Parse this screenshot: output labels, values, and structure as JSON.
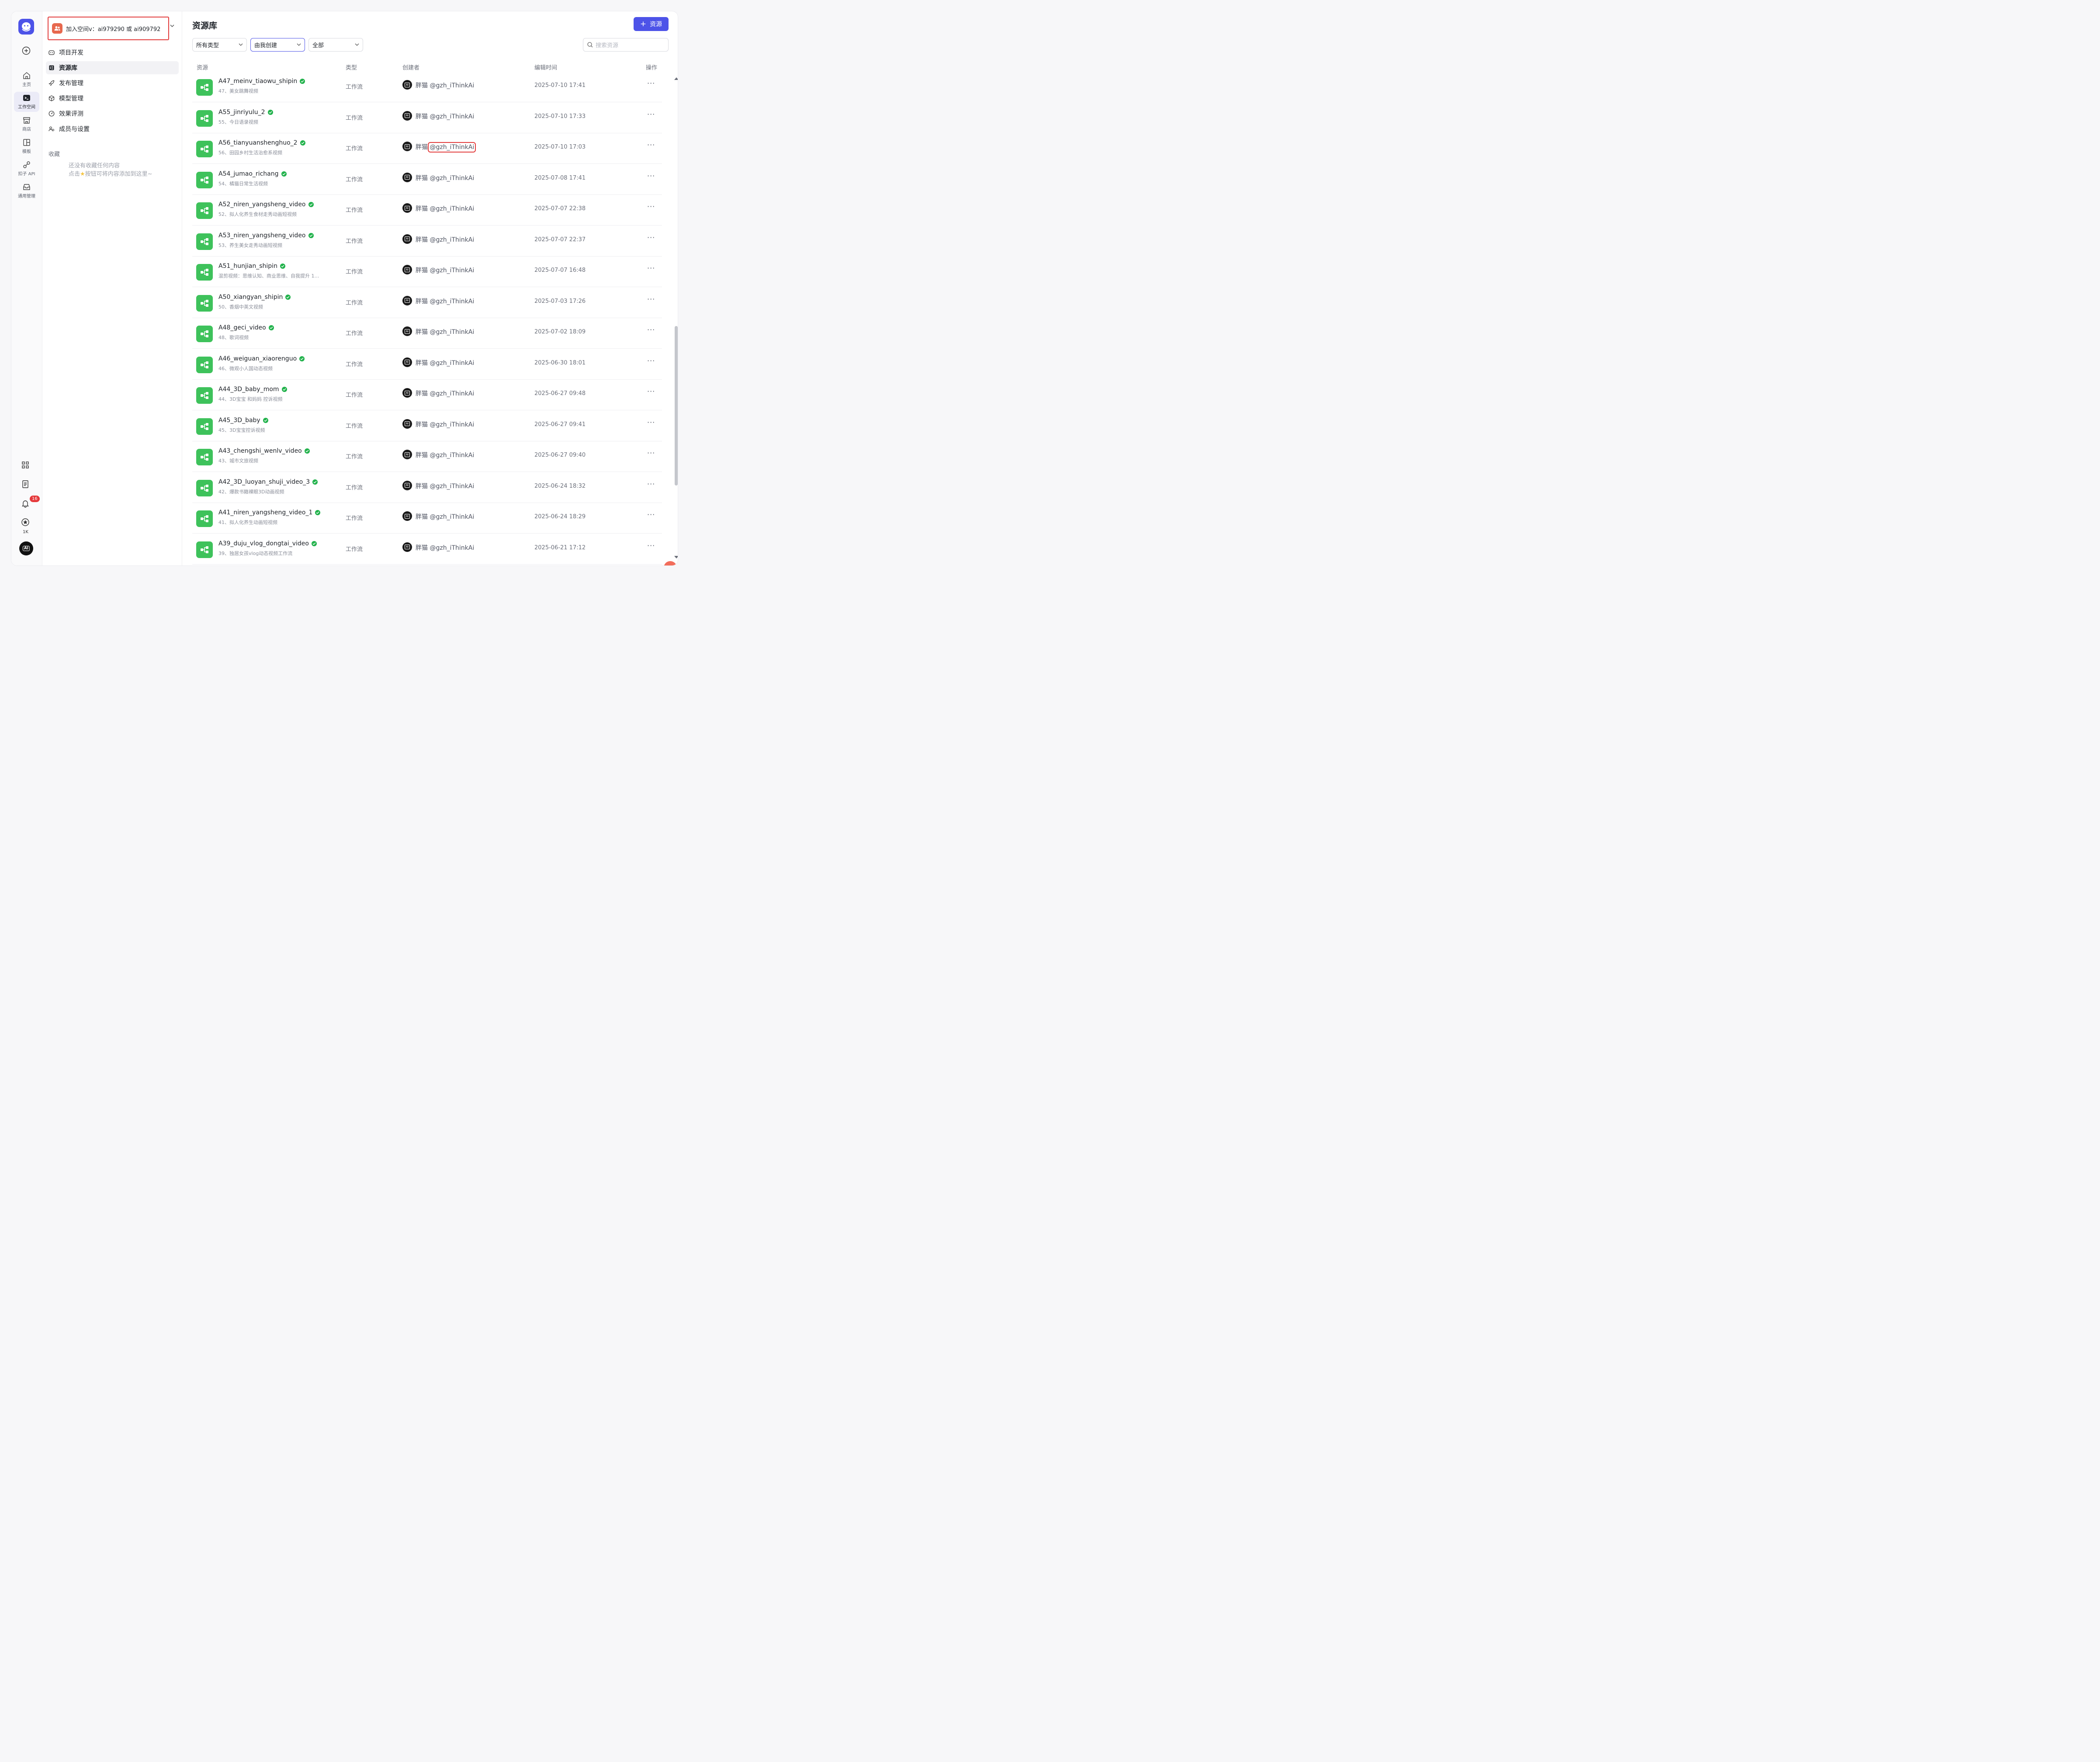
{
  "rail": {
    "items": [
      {
        "name": "home",
        "label": "主页"
      },
      {
        "name": "workspace",
        "label": "工作空间"
      },
      {
        "name": "store",
        "label": "商店"
      },
      {
        "name": "templates",
        "label": "模板"
      },
      {
        "name": "api",
        "label": "扣子 API"
      },
      {
        "name": "general",
        "label": "通用管理"
      }
    ],
    "notification_count": "16",
    "favorites_count": "1K",
    "avatar_text": "AI"
  },
  "subnav": {
    "space_label": "加入空间v：ai979290 或 ai909792",
    "items": [
      {
        "label": "项目开发"
      },
      {
        "label": "资源库"
      },
      {
        "label": "发布管理"
      },
      {
        "label": "模型管理"
      },
      {
        "label": "效果评测"
      },
      {
        "label": "成员与设置"
      }
    ],
    "favorites_title": "收藏",
    "favorites_empty_line1": "还没有收藏任何内容",
    "favorites_empty_line2_a": "点击",
    "favorites_empty_line2_b": "按钮可将内容添加到这里~"
  },
  "main": {
    "title": "资源库",
    "add_button": "资源",
    "filters": {
      "type": "所有类型",
      "creator": "由我创建",
      "status": "全部"
    },
    "search_placeholder": "搜索资源",
    "columns": {
      "resource": "资源",
      "type": "类型",
      "creator": "创建者",
      "edited": "编辑时间",
      "action": "操作"
    },
    "rows": [
      {
        "name": "A47_meinv_tiaowu_shipin",
        "desc": "47、美女跳舞视频",
        "type": "工作流",
        "creator": "胖猫",
        "handle": "@gzh_iThinkAi",
        "time": "2025-07-10 17:41"
      },
      {
        "name": "A55_jinriyulu_2",
        "desc": "55、今日语录视频",
        "type": "工作流",
        "creator": "胖猫",
        "handle": "@gzh_iThinkAi",
        "time": "2025-07-10 17:33"
      },
      {
        "name": "A56_tianyuanshenghuo_2",
        "desc": "56、田园乡村生活治愈系视频",
        "type": "工作流",
        "creator": "胖猫",
        "handle": "@gzh_iThinkAi",
        "time": "2025-07-10 17:03"
      },
      {
        "name": "A54_jumao_richang",
        "desc": "54、橘猫日常生活视频",
        "type": "工作流",
        "creator": "胖猫",
        "handle": "@gzh_iThinkAi",
        "time": "2025-07-08 17:41"
      },
      {
        "name": "A52_niren_yangsheng_video",
        "desc": "52、拟人化养生食材走秀动画短视频",
        "type": "工作流",
        "creator": "胖猫",
        "handle": "@gzh_iThinkAi",
        "time": "2025-07-07 22:38"
      },
      {
        "name": "A53_niren_yangsheng_video",
        "desc": "53、养生美女走秀动画短视频",
        "type": "工作流",
        "creator": "胖猫",
        "handle": "@gzh_iThinkAi",
        "time": "2025-07-07 22:37"
      },
      {
        "name": "A51_hunjian_shipin",
        "desc": "混剪视频：思维认知、商业思维、自我提升 1…",
        "type": "工作流",
        "creator": "胖猫",
        "handle": "@gzh_iThinkAi",
        "time": "2025-07-07 16:48"
      },
      {
        "name": "A50_xiangyan_shipin",
        "desc": "50、香烟中英文视频",
        "type": "工作流",
        "creator": "胖猫",
        "handle": "@gzh_iThinkAi",
        "time": "2025-07-03 17:26"
      },
      {
        "name": "A48_geci_video",
        "desc": "48、歌词视频",
        "type": "工作流",
        "creator": "胖猫",
        "handle": "@gzh_iThinkAi",
        "time": "2025-07-02 18:09"
      },
      {
        "name": "A46_weiguan_xiaorenguo",
        "desc": "46、微观小人国动态视频",
        "type": "工作流",
        "creator": "胖猫",
        "handle": "@gzh_iThinkAi",
        "time": "2025-06-30 18:01"
      },
      {
        "name": "A44_3D_baby_mom",
        "desc": "44、3D宝宝 和妈妈 控诉视频",
        "type": "工作流",
        "creator": "胖猫",
        "handle": "@gzh_iThinkAi",
        "time": "2025-06-27 09:48"
      },
      {
        "name": "A45_3D_baby",
        "desc": "45、3D宝宝控诉视频",
        "type": "工作流",
        "creator": "胖猫",
        "handle": "@gzh_iThinkAi",
        "time": "2025-06-27 09:41"
      },
      {
        "name": "A43_chengshi_wenlv_video",
        "desc": "43、城市文旅视频",
        "type": "工作流",
        "creator": "胖猫",
        "handle": "@gzh_iThinkAi",
        "time": "2025-06-27 09:40"
      },
      {
        "name": "A42_3D_luoyan_shuji_video_3",
        "desc": "42、爆款书籍裸眼3D动画视频",
        "type": "工作流",
        "creator": "胖猫",
        "handle": "@gzh_iThinkAi",
        "time": "2025-06-24 18:32"
      },
      {
        "name": "A41_niren_yangsheng_video_1",
        "desc": "41、拟人化养生动画短视频",
        "type": "工作流",
        "creator": "胖猫",
        "handle": "@gzh_iThinkAi",
        "time": "2025-06-24 18:29"
      },
      {
        "name": "A39_duju_vlog_dongtai_video",
        "desc": "39、独居女孩vlog动态视频工作流",
        "type": "工作流",
        "creator": "胖猫",
        "handle": "@gzh_iThinkAi",
        "time": "2025-06-21 17:12"
      }
    ]
  },
  "colors": {
    "accent": "#4d53e8",
    "workflow_icon": "#3ec25b",
    "verified": "#22b24c",
    "highlight": "#e23c3c"
  },
  "icons": [
    "plus-icon",
    "home-icon",
    "terminal-icon",
    "store-icon",
    "template-icon",
    "api-icon",
    "inbox-icon",
    "grid-icon",
    "doc-icon",
    "bell-icon",
    "star-icon",
    "search-icon",
    "chevron-down-icon",
    "workflow-icon",
    "check-icon",
    "more-icon"
  ]
}
